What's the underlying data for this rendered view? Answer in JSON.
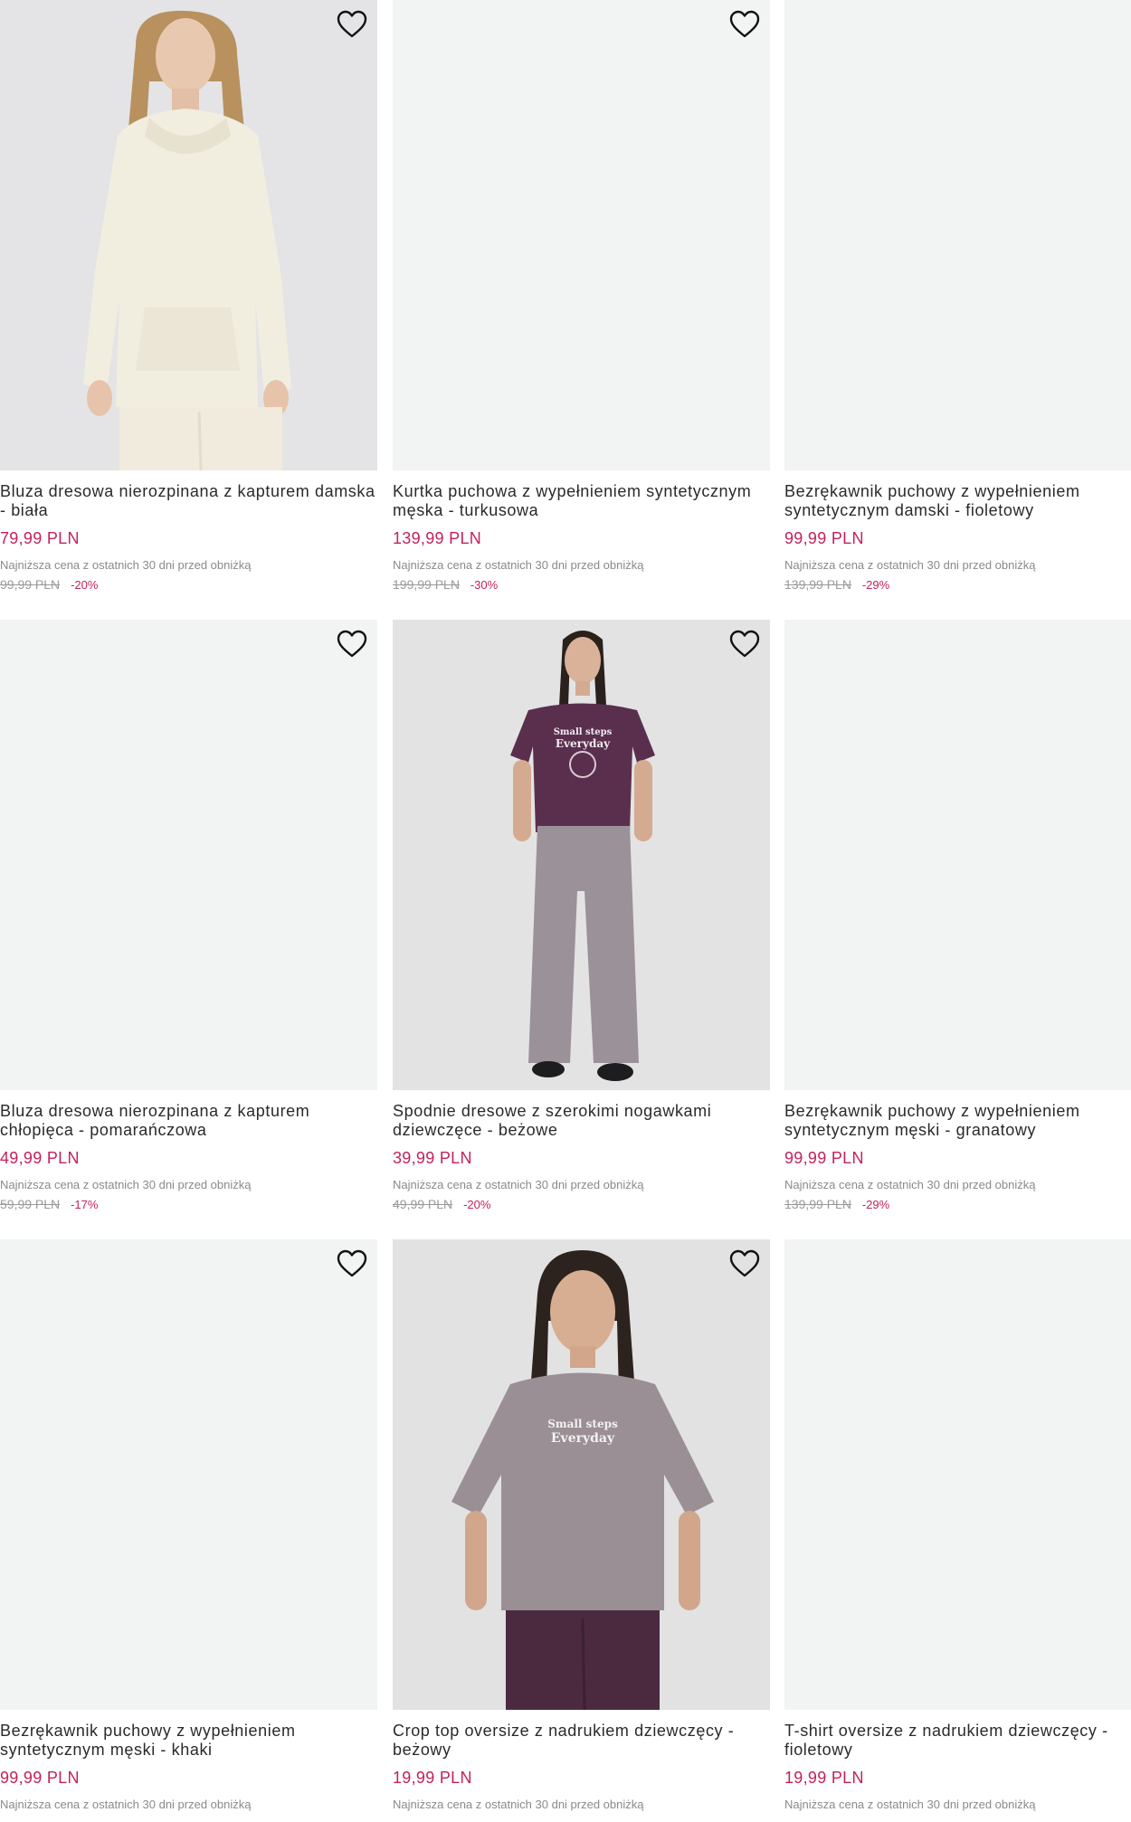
{
  "products": [
    {
      "title": "Bluza dresowa nierozpinana z kapturem damska - biała",
      "price": "79,99 PLN",
      "lowest_label": "Najniższa cena z ostatnich 30 dni przed obniżką",
      "old_price": "99,99 PLN",
      "discount": "-20%",
      "image": "woman-white-hoodie"
    },
    {
      "title": "Kurtka puchowa z wypełnieniem syntetycznym męska - turkusowa",
      "price": "139,99 PLN",
      "lowest_label": "Najniższa cena z ostatnich 30 dni przed obniżką",
      "old_price": "199,99 PLN",
      "discount": "-30%",
      "image": "blank"
    },
    {
      "title": "Bezrękawnik puchowy z wypełnieniem syntetycznym damski - fioletowy",
      "price": "99,99 PLN",
      "lowest_label": "Najniższa cena z ostatnich 30 dni przed obniżką",
      "old_price": "139,99 PLN",
      "discount": "-29%",
      "image": "blank"
    },
    {
      "title": "Bluza dresowa nierozpinana z kapturem chłopięca - pomarańczowa",
      "price": "49,99 PLN",
      "lowest_label": "Najniższa cena z ostatnich 30 dni przed obniżką",
      "old_price": "59,99 PLN",
      "discount": "-17%",
      "image": "blank"
    },
    {
      "title": "Spodnie dresowe z szerokimi nogawkami dziewczęce - beżowe",
      "price": "39,99 PLN",
      "lowest_label": "Najniższa cena z ostatnich 30 dni przed obniżką",
      "old_price": "49,99 PLN",
      "discount": "-20%",
      "image": "girl-purple-tee-grey-pants"
    },
    {
      "title": "Bezrękawnik puchowy z wypełnieniem syntetycznym męski - granatowy",
      "price": "99,99 PLN",
      "lowest_label": "Najniższa cena z ostatnich 30 dni przed obniżką",
      "old_price": "139,99 PLN",
      "discount": "-29%",
      "image": "blank"
    },
    {
      "title": "Bezrękawnik puchowy z wypełnieniem syntetycznym męski - khaki",
      "price": "99,99 PLN",
      "lowest_label": "Najniższa cena z ostatnich 30 dni przed obniżką",
      "old_price": "",
      "discount": "",
      "image": "blank"
    },
    {
      "title": "Crop top oversize z nadrukiem dziewczęcy - beżowy",
      "price": "19,99 PLN",
      "lowest_label": "Najniższa cena z ostatnich 30 dni przed obniżką",
      "old_price": "",
      "discount": "",
      "image": "girl-grey-crop-top"
    },
    {
      "title": "T-shirt oversize z nadrukiem dziewczęcy - fioletowy",
      "price": "19,99 PLN",
      "lowest_label": "Najniższa cena z ostatnich 30 dni przed obniżką",
      "old_price": "",
      "discount": "",
      "image": "blank"
    }
  ],
  "print_text": {
    "line1": "Small steps",
    "line2": "Everyday"
  },
  "colors": {
    "price": "#c4215c",
    "image_bg": "#f2f4f3"
  },
  "icons": {
    "favorite": "heart-outline-icon"
  }
}
